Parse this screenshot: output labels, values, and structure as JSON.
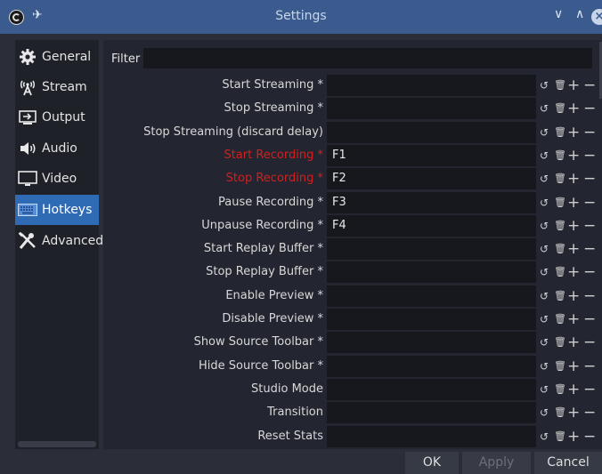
{
  "window": {
    "title": "Settings"
  },
  "sidebar": {
    "items": [
      {
        "label": "General",
        "icon": "gear-icon"
      },
      {
        "label": "Stream",
        "icon": "broadcast-icon"
      },
      {
        "label": "Output",
        "icon": "output-icon"
      },
      {
        "label": "Audio",
        "icon": "speaker-icon"
      },
      {
        "label": "Video",
        "icon": "monitor-icon"
      },
      {
        "label": "Hotkeys",
        "icon": "keyboard-icon",
        "active": true
      },
      {
        "label": "Advanced",
        "icon": "tools-icon"
      }
    ]
  },
  "filter": {
    "label": "Filter",
    "value": ""
  },
  "hotkeys": [
    {
      "label": "Start Streaming *",
      "key": "",
      "highlight": false
    },
    {
      "label": "Stop Streaming *",
      "key": "",
      "highlight": false
    },
    {
      "label": "Stop Streaming (discard delay)",
      "key": "",
      "highlight": false
    },
    {
      "label": "Start Recording *",
      "key": "F1",
      "highlight": true
    },
    {
      "label": "Stop Recording *",
      "key": "F2",
      "highlight": true
    },
    {
      "label": "Pause Recording *",
      "key": "F3",
      "highlight": false
    },
    {
      "label": "Unpause Recording *",
      "key": "F4",
      "highlight": false
    },
    {
      "label": "Start Replay Buffer *",
      "key": "",
      "highlight": false
    },
    {
      "label": "Stop Replay Buffer *",
      "key": "",
      "highlight": false
    },
    {
      "label": "Enable Preview *",
      "key": "",
      "highlight": false
    },
    {
      "label": "Disable Preview *",
      "key": "",
      "highlight": false
    },
    {
      "label": "Show Source Toolbar *",
      "key": "",
      "highlight": false
    },
    {
      "label": "Hide Source Toolbar *",
      "key": "",
      "highlight": false
    },
    {
      "label": "Studio Mode",
      "key": "",
      "highlight": false
    },
    {
      "label": "Transition",
      "key": "",
      "highlight": false
    },
    {
      "label": "Reset Stats",
      "key": "",
      "highlight": false
    }
  ],
  "buttons": {
    "ok": "OK",
    "apply": "Apply",
    "cancel": "Cancel"
  },
  "colors": {
    "titlebar": "#3b5b8e",
    "active": "#2f6ab5",
    "conflict": "#d22020"
  }
}
